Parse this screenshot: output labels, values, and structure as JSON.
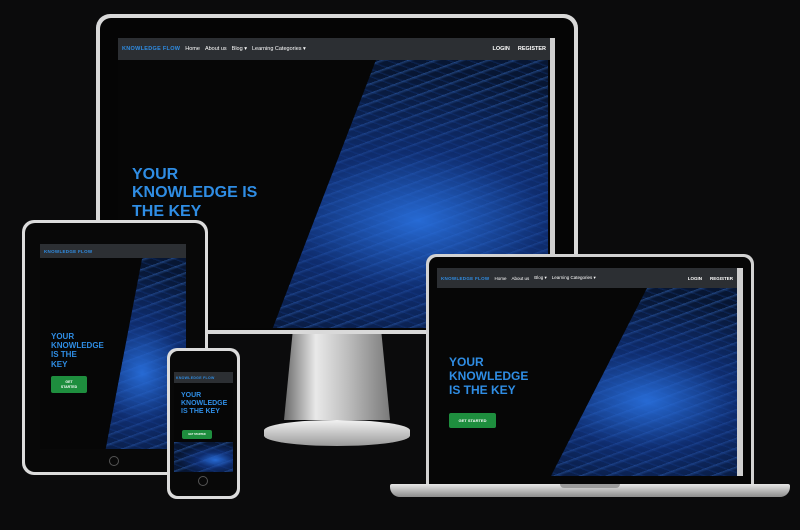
{
  "brand": {
    "name": "KNOWLEDGE FLOW"
  },
  "nav": {
    "links": [
      "Home",
      "About us",
      "Blog ▾",
      "Learning Categories ▾"
    ],
    "login": "LOGIN",
    "register": "REGISTER"
  },
  "hero": {
    "lines_wide": [
      "YOUR",
      "KNOWLEDGE IS",
      "THE KEY"
    ],
    "lines_laptop": [
      "YOUR",
      "KNOWLEDGE",
      "IS THE KEY"
    ],
    "lines_tablet": [
      "YOUR",
      "KNOWLEDGE",
      "IS THE",
      "KEY"
    ],
    "lines_phone": [
      "YOUR",
      "KNOWLEDGE",
      "IS THE KEY"
    ],
    "cta": "GET STARTED",
    "cta_tablet_lines": [
      "GET",
      "STARTED"
    ]
  },
  "colors": {
    "accent": "#2f8de4",
    "cta": "#1e8e3e",
    "nav_bg": "#2c2f33",
    "page_bg": "#0b0b0c"
  }
}
